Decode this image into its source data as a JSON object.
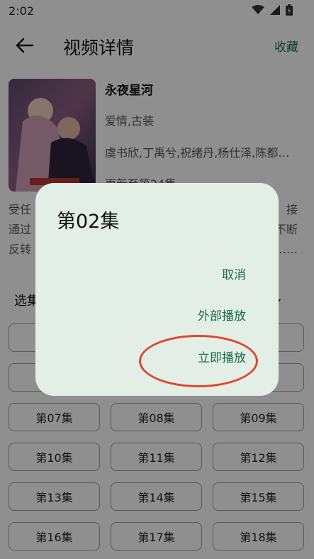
{
  "status": {
    "time": "2:02"
  },
  "appbar": {
    "title": "视频详情",
    "fav_label": "收藏"
  },
  "video": {
    "title": "永夜星河",
    "genre": "爱情,古装",
    "cast": "虞书欣,丁禹兮,祝绪丹,杨仕泽,陈都…",
    "update": "更新至第24集"
  },
  "description": {
    "line1_left": "受任",
    "line1_right": "接",
    "line2_left": "通过",
    "line2_right": "不断",
    "line3_left": "反转",
    "line3_right": "……"
  },
  "episodes_header": {
    "label": "选集",
    "right": "⇅"
  },
  "episodes": [
    "第07集",
    "第08集",
    "第09集",
    "第10集",
    "第11集",
    "第12集",
    "第13集",
    "第14集",
    "第15集",
    "第16集",
    "第17集",
    "第18集"
  ],
  "dialog": {
    "title": "第02集",
    "cancel": "取消",
    "external": "外部播放",
    "play_now": "立即播放"
  },
  "colors": {
    "accent": "#1b6b45",
    "highlight_circle": "#e0462d",
    "dialog_bg": "#e3efe6"
  }
}
